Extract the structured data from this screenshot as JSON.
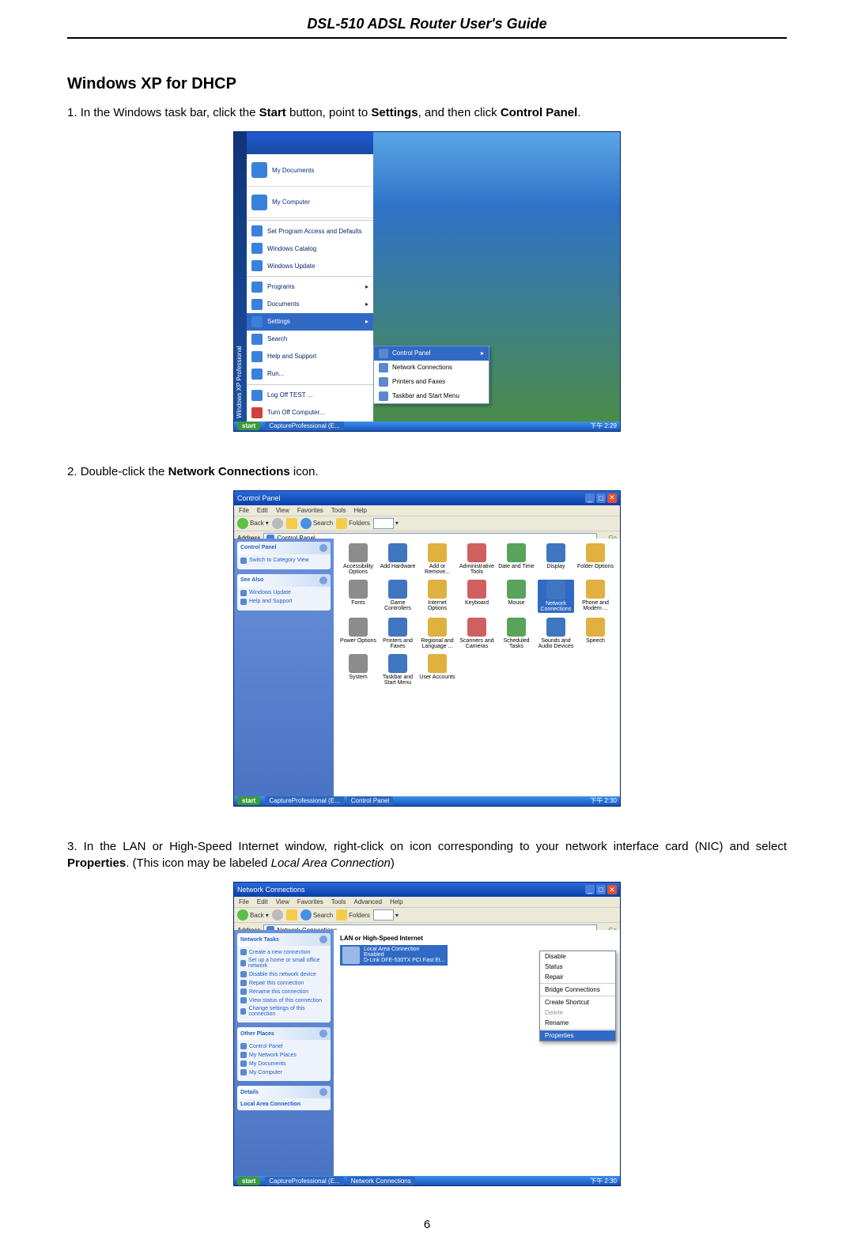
{
  "doc_header": "DSL-510 ADSL Router User's Guide",
  "section_heading": "Windows XP for DHCP",
  "page_number": "6",
  "step1": {
    "num": "1. ",
    "t1": "In the Windows task bar, click the ",
    "b1": "Start",
    "t2": " button, point to ",
    "b2": "Settings",
    "t3": ", and then click ",
    "b3": "Control Panel",
    "t4": "."
  },
  "step2": {
    "num": "2. ",
    "t1": "Double-click the ",
    "b1": "Network Connections",
    "t2": " icon."
  },
  "step3": {
    "num": "3. ",
    "t1": "In the LAN or High-Speed Internet window, right-click on icon corresponding to your network interface card (NIC) and select ",
    "b1": "Properties",
    "t2": ". (This icon may be labeled ",
    "i1": "Local Area Connection",
    "t3": ")"
  },
  "fig1": {
    "vbar": "Windows XP   Professional",
    "hdr1": "My Documents",
    "hdr2": "My Computer",
    "items": {
      "spad": "Set Program Access and Defaults",
      "wincat": "Windows Catalog",
      "winupd": "Windows Update",
      "programs": "Programs",
      "documents": "Documents",
      "settings": "Settings",
      "search": "Search",
      "help": "Help and Support",
      "run": "Run...",
      "logoff": "Log Off TEST ...",
      "turnoff": "Turn Off Computer..."
    },
    "submenu": {
      "cp": "Control Panel",
      "nc": "Network Connections",
      "pf": "Printers and Faxes",
      "tb": "Taskbar and Start Menu"
    },
    "taskbar": {
      "start": "start",
      "task1": "CaptureProfessional (E...",
      "tray": "下午 2:29"
    }
  },
  "fig2": {
    "title": "Control Panel",
    "menu": [
      "File",
      "Edit",
      "View",
      "Favorites",
      "Tools",
      "Help"
    ],
    "tb": {
      "back": "Back",
      "search": "Search",
      "folders": "Folders"
    },
    "addr_lbl": "Address",
    "addr_value": "Control Panel",
    "go": "Go",
    "side": {
      "box1_title": "Control Panel",
      "box1_ln": "Switch to Category View",
      "box2_title": "See Also",
      "box2_ln1": "Windows Update",
      "box2_ln2": "Help and Support"
    },
    "icons": [
      "Accessibility Options",
      "Add Hardware",
      "Add or Remove...",
      "Administrative Tools",
      "Date and Time",
      "Display",
      "Folder Options",
      "Fonts",
      "Game Controllers",
      "Internet Options",
      "Keyboard",
      "Mouse",
      "Network Connections",
      "Phone and Modem ...",
      "Power Options",
      "Printers and Faxes",
      "Regional and Language ...",
      "Scanners and Cameras",
      "Scheduled Tasks",
      "Sounds and Audio Devices",
      "Speech",
      "System",
      "Taskbar and Start Menu",
      "User Accounts"
    ],
    "icons_hl_index": 12,
    "taskbar": {
      "start": "start",
      "task1": "CaptureProfessional (E...",
      "task2": "Control Panel",
      "tray": "下午 2:30"
    }
  },
  "fig3": {
    "title": "Network Connections",
    "menu": [
      "File",
      "Edit",
      "View",
      "Favorites",
      "Tools",
      "Advanced",
      "Help"
    ],
    "tb": {
      "back": "Back",
      "search": "Search",
      "folders": "Folders"
    },
    "addr_lbl": "Address",
    "addr_value": "Network Connections",
    "go": "Go",
    "side": {
      "box1_title": "Network Tasks",
      "box1": [
        "Create a new connection",
        "Set up a home or small office network",
        "Disable this network device",
        "Repair this connection",
        "Rename this connection",
        "View status of this connection",
        "Change settings of this connection"
      ],
      "box2_title": "Other Places",
      "box2": [
        "Control Panel",
        "My Network Places",
        "My Documents",
        "My Computer"
      ],
      "box3_title": "Details",
      "box3_sub": "Local Area Connection"
    },
    "section": "LAN or High-Speed Internet",
    "conn": {
      "name": "Local Area Connection",
      "state": "Enabled",
      "device": "D-Link DFE-530TX PCI Fast Et..."
    },
    "ctx": [
      "Disable",
      "Status",
      "Repair",
      "Bridge Connections",
      "Create Shortcut",
      "Delete",
      "Rename",
      "Properties"
    ],
    "taskbar": {
      "start": "start",
      "task1": "CaptureProfessional (E...",
      "task2": "Network Connections",
      "tray": "下午 2:30"
    }
  }
}
